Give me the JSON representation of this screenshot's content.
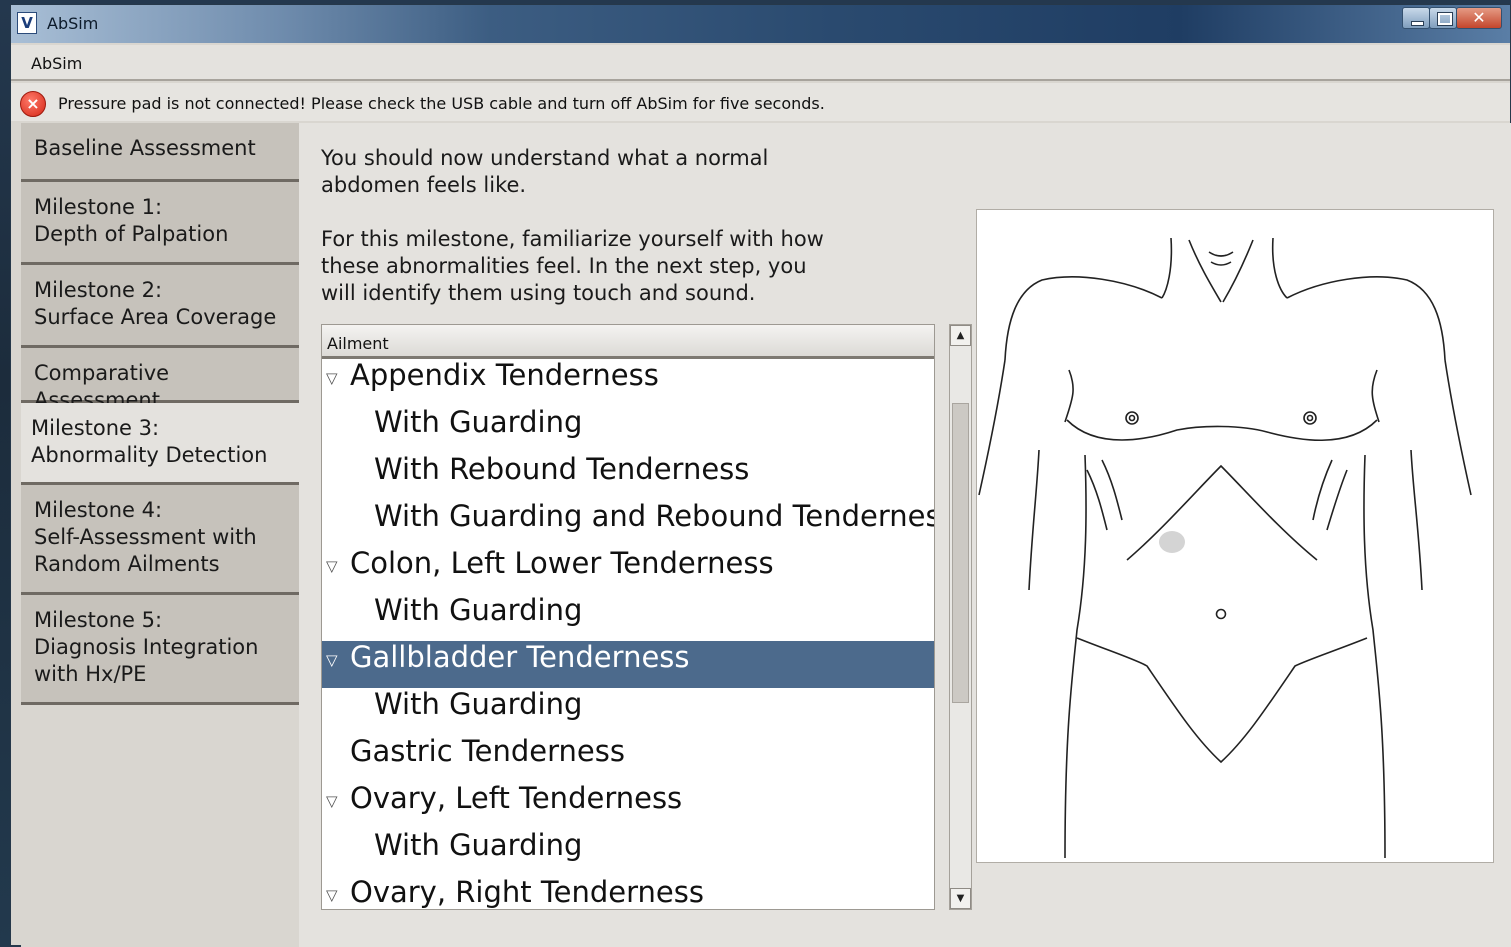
{
  "window": {
    "title": "AbSim"
  },
  "menu": {
    "items": [
      "AbSim"
    ]
  },
  "alert": {
    "message": "Pressure pad is not connected! Please check the USB cable and turn off AbSim for five seconds."
  },
  "sidebar": {
    "items": [
      {
        "lines": [
          "Baseline Assessment"
        ]
      },
      {
        "lines": [
          "Milestone 1:",
          "Depth of Palpation"
        ]
      },
      {
        "lines": [
          "Milestone 2:",
          "Surface Area Coverage"
        ]
      },
      {
        "lines": [
          "Comparative Assessment"
        ]
      },
      {
        "lines": [
          "Milestone 3:",
          "Abnormality Detection"
        ],
        "active": true
      },
      {
        "lines": [
          "Milestone 4:",
          "Self-Assessment with",
          "Random Ailments"
        ]
      },
      {
        "lines": [
          "Milestone 5:",
          "Diagnosis Integration",
          "with Hx/PE"
        ]
      }
    ]
  },
  "main": {
    "intro_line1": "You should now understand what a normal",
    "intro_line2": "abdomen feels like.",
    "intro_line3": "For this milestone, familiarize yourself with how",
    "intro_line4": "these abnormalities feel. In the next step, you",
    "intro_line5": "will identify them using touch and sound."
  },
  "tree": {
    "header": "Ailment",
    "rows": [
      {
        "label": "Appendix Tenderness",
        "level": 0,
        "expanded": true
      },
      {
        "label": "With Guarding",
        "level": 1
      },
      {
        "label": "With Rebound Tenderness",
        "level": 1
      },
      {
        "label": "With Guarding and Rebound Tenderness",
        "level": 1
      },
      {
        "label": "Colon, Left Lower Tenderness",
        "level": 0,
        "expanded": true
      },
      {
        "label": "With Guarding",
        "level": 1
      },
      {
        "label": "Gallbladder Tenderness",
        "level": 0,
        "expanded": true,
        "selected": true
      },
      {
        "label": "With Guarding",
        "level": 1
      },
      {
        "label": "Gastric Tenderness",
        "level": 0
      },
      {
        "label": "Ovary, Left Tenderness",
        "level": 0,
        "expanded": true
      },
      {
        "label": "With Guarding",
        "level": 1
      },
      {
        "label": "Ovary, Right Tenderness",
        "level": 0,
        "expanded": true
      }
    ]
  },
  "colors": {
    "selection": "#4c6a8c",
    "sidebar_bg": "#c6c2bb",
    "alert_icon": "#d42615"
  }
}
